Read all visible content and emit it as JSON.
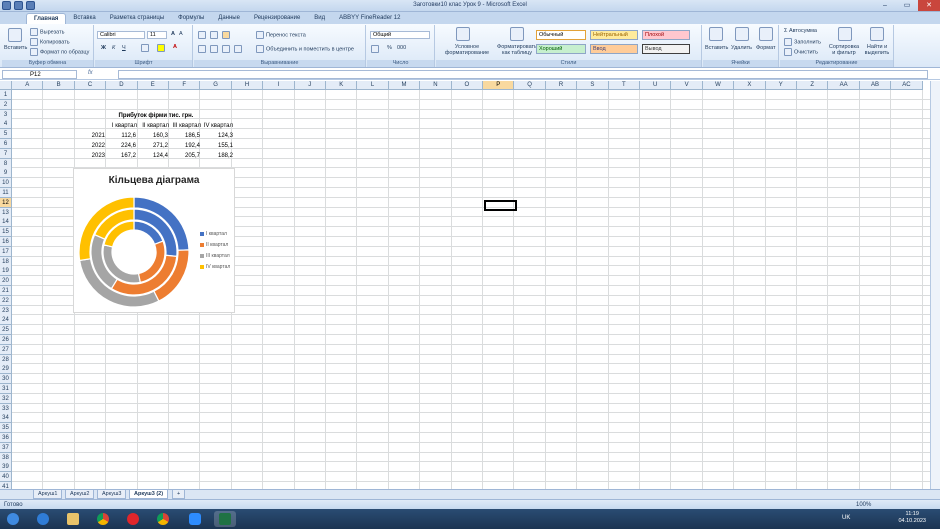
{
  "window": {
    "title": "Заготовки10 клас Урок 9 - Microsoft Excel",
    "controls": [
      "–",
      "▭",
      "✕"
    ]
  },
  "ribbon_tabs": [
    "Главная",
    "Вставка",
    "Разметка страницы",
    "Формулы",
    "Данные",
    "Рецензирование",
    "Вид",
    "ABBYY FineReader 12"
  ],
  "clipboard": {
    "paste": "Вставить",
    "cut": "Вырезать",
    "copy": "Копировать",
    "format_painter": "Формат по образцу",
    "label": "Буфер обмена"
  },
  "font": {
    "name": "Calibri",
    "size": "11",
    "label": "Шрифт"
  },
  "alignment": {
    "wrap": "Перенос текста",
    "merge": "Объединить и поместить в центре",
    "label": "Выравнивание"
  },
  "number": {
    "format": "Общий",
    "label": "Число"
  },
  "styles": {
    "cond": "Условное форматирование",
    "astable": "Форматировать как таблицу",
    "normal": "Обычный",
    "neutral": "Нейтральный",
    "bad": "Плохой",
    "good": "Хороший",
    "input": "Ввод",
    "output": "Вывод",
    "label": "Стили"
  },
  "cells": {
    "insert": "Вставить",
    "delete": "Удалить",
    "format": "Формат",
    "label": "Ячейки"
  },
  "editing": {
    "autosum": "Автосумма",
    "fill": "Заполнить",
    "clear": "Очистить",
    "sort": "Сортировка и фильтр",
    "find": "Найти и выделить",
    "label": "Редактирование"
  },
  "formula_bar": {
    "name_box": "P12",
    "fx": "fx",
    "value": ""
  },
  "columns": [
    "A",
    "B",
    "C",
    "D",
    "E",
    "F",
    "G",
    "H",
    "I",
    "J",
    "K",
    "L",
    "M",
    "N",
    "O",
    "P",
    "Q",
    "R",
    "S",
    "T",
    "U",
    "V",
    "W",
    "X",
    "Y",
    "Z",
    "AA",
    "AB",
    "AC"
  ],
  "selected": {
    "col": "P",
    "row": 12
  },
  "table": {
    "title": "Прибуток фірми тис. грн.",
    "headers": [
      "І квартал",
      "ІІ квартал",
      "ІІІ квартал",
      "ІV квартал"
    ],
    "rows": [
      {
        "year": "2021",
        "values": [
          "112,6",
          "160,3",
          "186,5",
          "124,3"
        ]
      },
      {
        "year": "2022",
        "values": [
          "224,6",
          "271,2",
          "192,4",
          "155,1"
        ]
      },
      {
        "year": "2023",
        "values": [
          "167,2",
          "124,4",
          "205,7",
          "188,2"
        ]
      }
    ]
  },
  "chart_data": {
    "type": "doughnut",
    "title": "Кільцева діаграма",
    "categories": [
      "І квартал",
      "ІІ квартал",
      "ІІІ квартал",
      "ІV квартал"
    ],
    "series": [
      {
        "name": "2021",
        "values": [
          112.6,
          160.3,
          186.5,
          124.3
        ]
      },
      {
        "name": "2022",
        "values": [
          224.6,
          271.2,
          192.4,
          155.1
        ]
      },
      {
        "name": "2023",
        "values": [
          167.2,
          124.4,
          205.7,
          188.2
        ]
      }
    ],
    "colors": [
      "#4472C4",
      "#ED7D31",
      "#A5A5A5",
      "#FFC000"
    ],
    "legend": "right"
  },
  "sheet_tabs": [
    "Аркуш1",
    "Аркуш2",
    "Аркуш3",
    "Аркуш3 (2)"
  ],
  "active_sheet": "Аркуш3 (2)",
  "status": "Готово",
  "zoom": "100%",
  "clock": {
    "time": "11:19",
    "date": "04.10.2023"
  },
  "lang": "UK"
}
